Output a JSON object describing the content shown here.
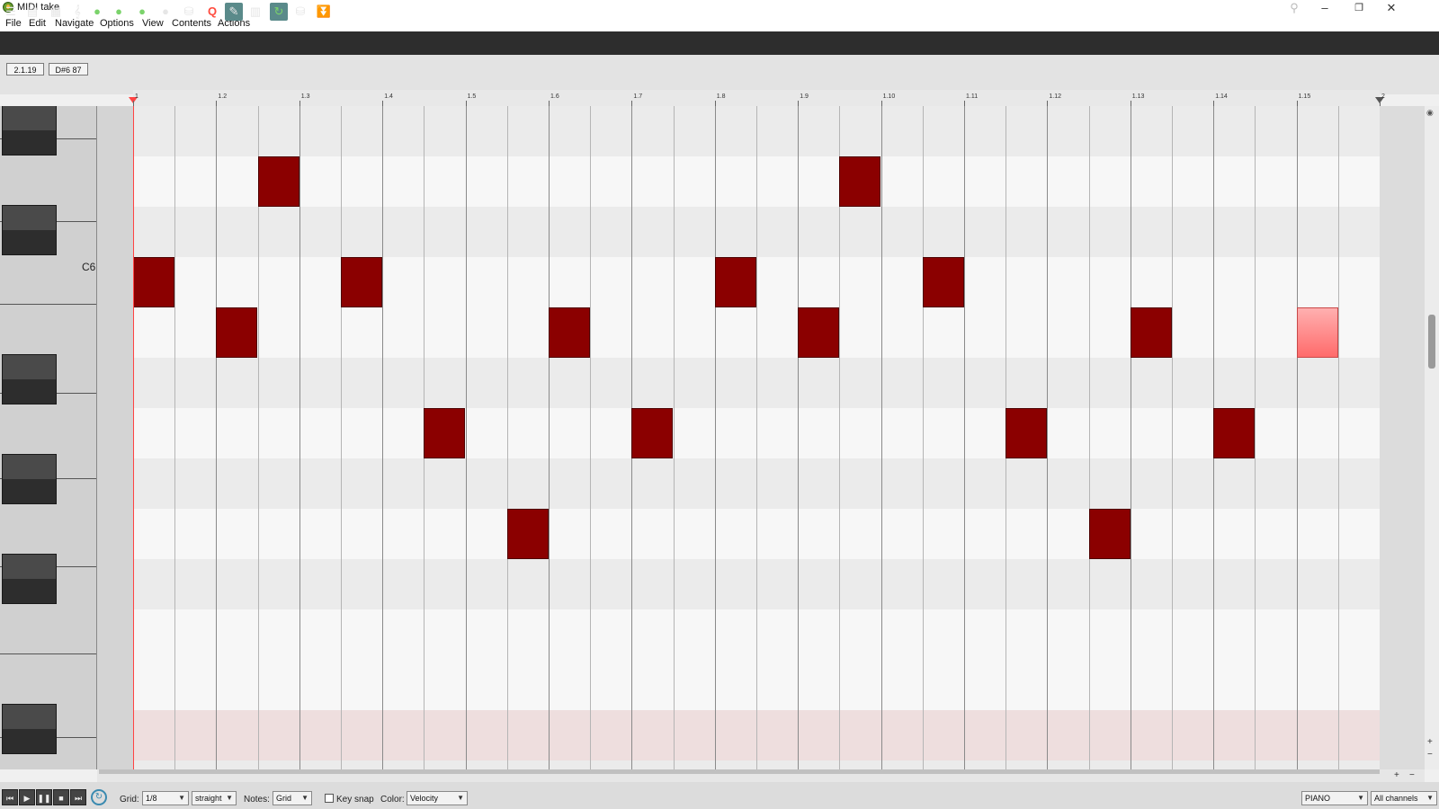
{
  "window": {
    "title": "MIDI take",
    "minimize_label": "–",
    "maximize_label": "❐",
    "close_label": "✕",
    "pin_label": "⚲"
  },
  "menu": [
    "File",
    "Edit",
    "Navigate",
    "Options",
    "View",
    "Contents",
    "Actions"
  ],
  "toolbar": {
    "icons": [
      "list-view-icon",
      "event-list-icon",
      "piano-roll-view-icon",
      "notation-view-icon",
      "insert-note-icon",
      "step-input-icon",
      "play-notes-icon",
      "chase-icon",
      "midi-input-icon",
      "quantize-icon",
      "select-mode-icon",
      "grid-view-icon",
      "loop-icon",
      "snap-icon",
      "tilde-input-icon"
    ],
    "glyphs": [
      "☰",
      "▤",
      "▦",
      "𝄞",
      "●",
      "●",
      "●",
      "●",
      "⛁",
      "▦",
      "Q",
      "✎",
      "▥",
      "↻",
      "⛁",
      "⏬"
    ]
  },
  "position": {
    "time": "2.1.19",
    "note": "D#6 87"
  },
  "ruler": {
    "labels": [
      "1",
      "1.2",
      "1.3",
      "1.4",
      "1.5",
      "1.6",
      "1.7",
      "1.8",
      "1.9",
      "1.10",
      "1.11",
      "1.12",
      "1.13",
      "1.14",
      "1.15",
      "2"
    ]
  },
  "keyboard": {
    "c6_label": "C6"
  },
  "notes": [
    {
      "row": 3,
      "start": 0,
      "len": 1
    },
    {
      "row": 4,
      "start": 2,
      "len": 1
    },
    {
      "row": 1,
      "start": 3,
      "len": 1
    },
    {
      "row": 3,
      "start": 5,
      "len": 1
    },
    {
      "row": 6,
      "start": 7,
      "len": 1
    },
    {
      "row": 8,
      "start": 9,
      "len": 1
    },
    {
      "row": 4,
      "start": 10,
      "len": 1
    },
    {
      "row": 6,
      "start": 12,
      "len": 1
    },
    {
      "row": 3,
      "start": 14,
      "len": 1
    },
    {
      "row": 4,
      "start": 16,
      "len": 1
    },
    {
      "row": 1,
      "start": 17,
      "len": 1
    },
    {
      "row": 3,
      "start": 19,
      "len": 1
    },
    {
      "row": 6,
      "start": 21,
      "len": 1
    },
    {
      "row": 8,
      "start": 23,
      "len": 1
    },
    {
      "row": 4,
      "start": 24,
      "len": 1
    },
    {
      "row": 6,
      "start": 26,
      "len": 1
    },
    {
      "row": 4,
      "start": 28,
      "len": 1,
      "selected": true
    }
  ],
  "colors": {
    "note": "#8b0000",
    "note_selected": "#ff7070",
    "row_light": "#f7f7f7",
    "row_dark": "#ebebeb",
    "row_highlight": "#eedede",
    "playhead": "#ff4444"
  },
  "bottombar": {
    "grid_label": "Grid:",
    "grid_value": "1/8",
    "grid_type": "straight",
    "notes_label": "Notes:",
    "notes_value": "Grid",
    "keysnap_label": "Key snap",
    "color_label": "Color:",
    "color_value": "Velocity",
    "mode_value": "PIANO",
    "channel_value": "All channels"
  }
}
